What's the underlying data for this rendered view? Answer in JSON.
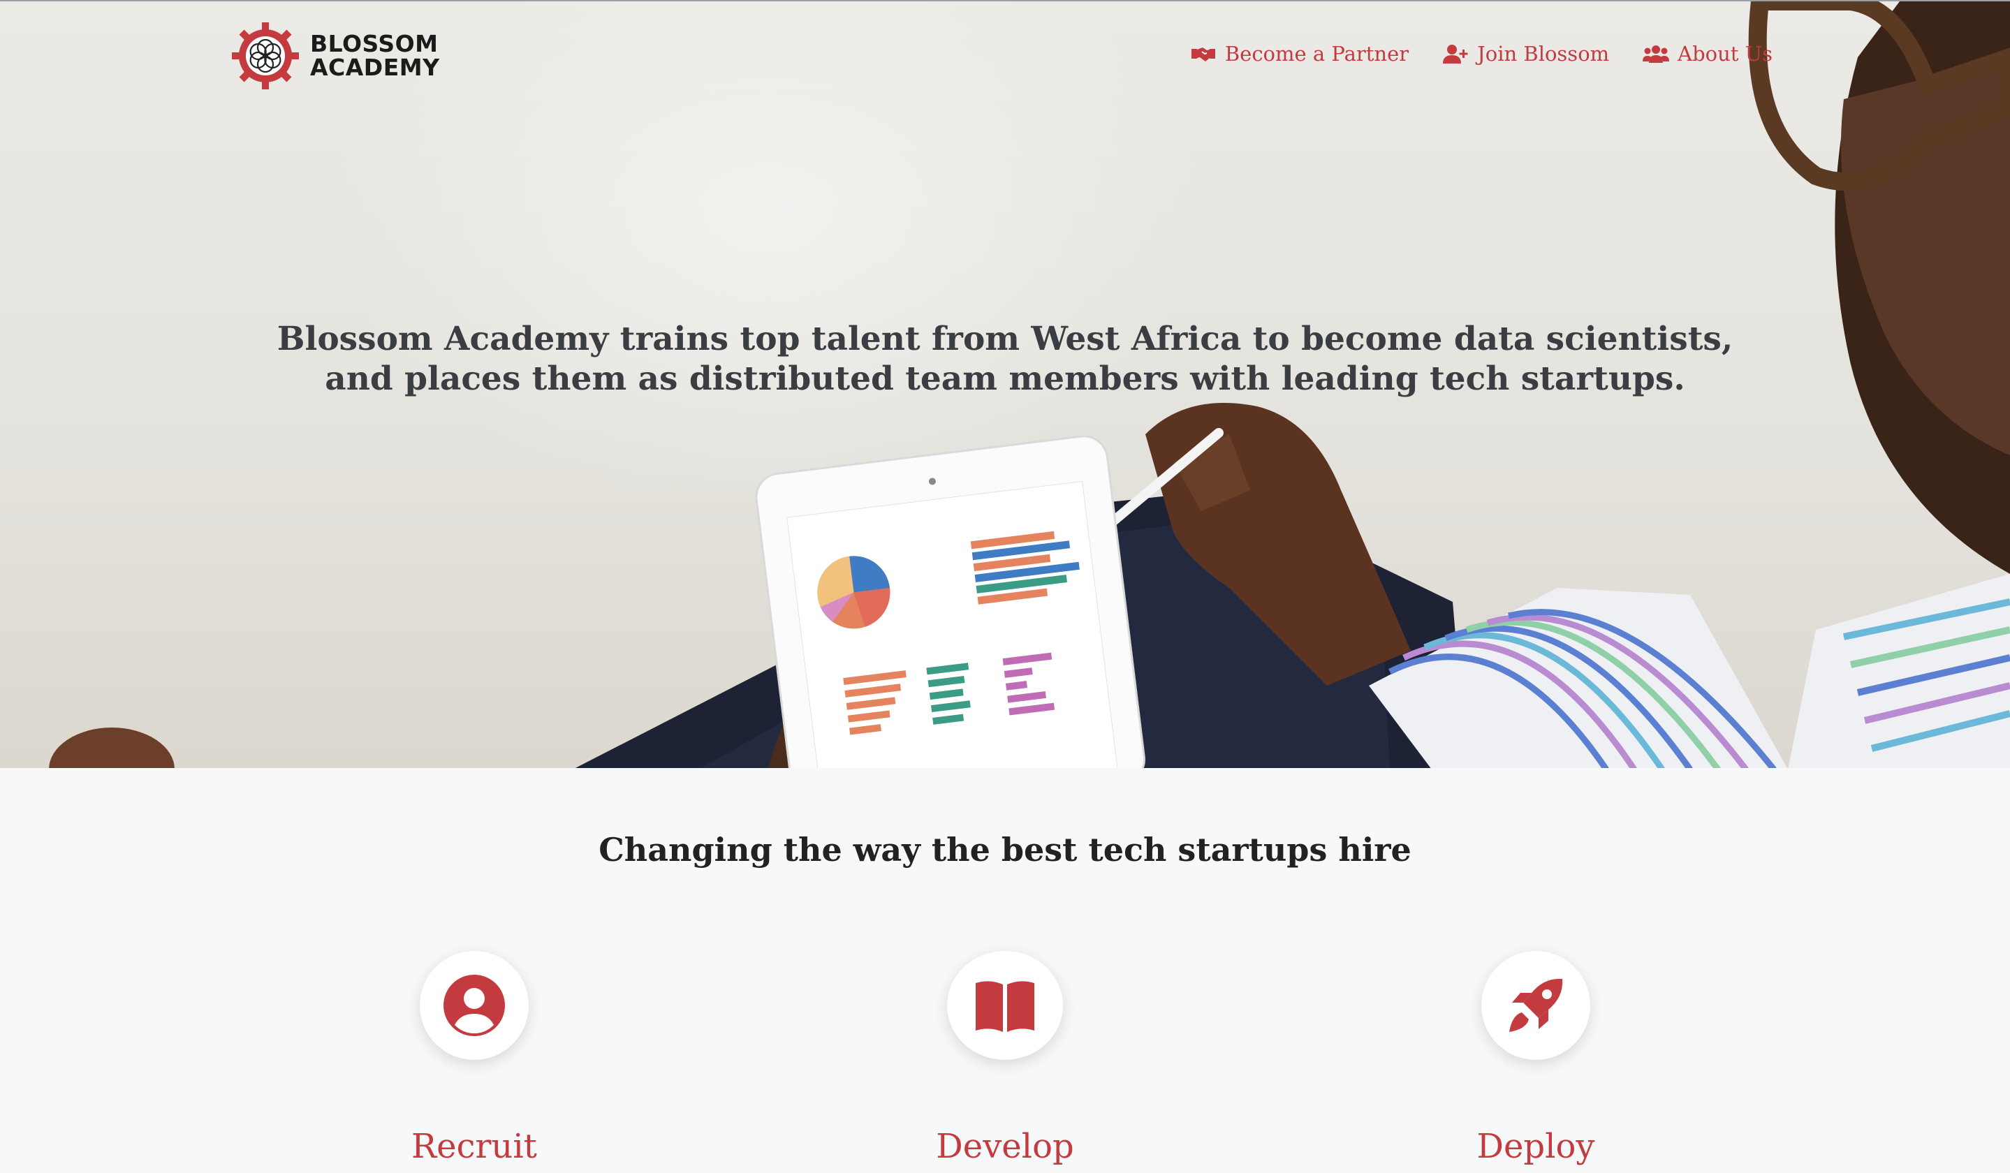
{
  "brand": {
    "name_line1": "BLOSSOM",
    "name_line2": "ACADEMY"
  },
  "nav": {
    "items": [
      {
        "label": "Become a Partner",
        "icon": "handshake-icon"
      },
      {
        "label": "Join Blossom",
        "icon": "user-plus-icon"
      },
      {
        "label": "About Us",
        "icon": "users-icon"
      }
    ]
  },
  "hero": {
    "headline": "Blossom Academy trains top talent from West Africa to become data scientists, and places them as distributed team members with leading tech startups."
  },
  "section": {
    "title": "Changing the way the best tech startups hire",
    "features": [
      {
        "label": "Recruit",
        "icon": "user-circle-icon"
      },
      {
        "label": "Develop",
        "icon": "open-book-icon"
      },
      {
        "label": "Deploy",
        "icon": "rocket-icon"
      }
    ]
  },
  "colors": {
    "accent": "#c33b3f",
    "headline": "#3a3d42",
    "background": "#f7f8fa"
  }
}
